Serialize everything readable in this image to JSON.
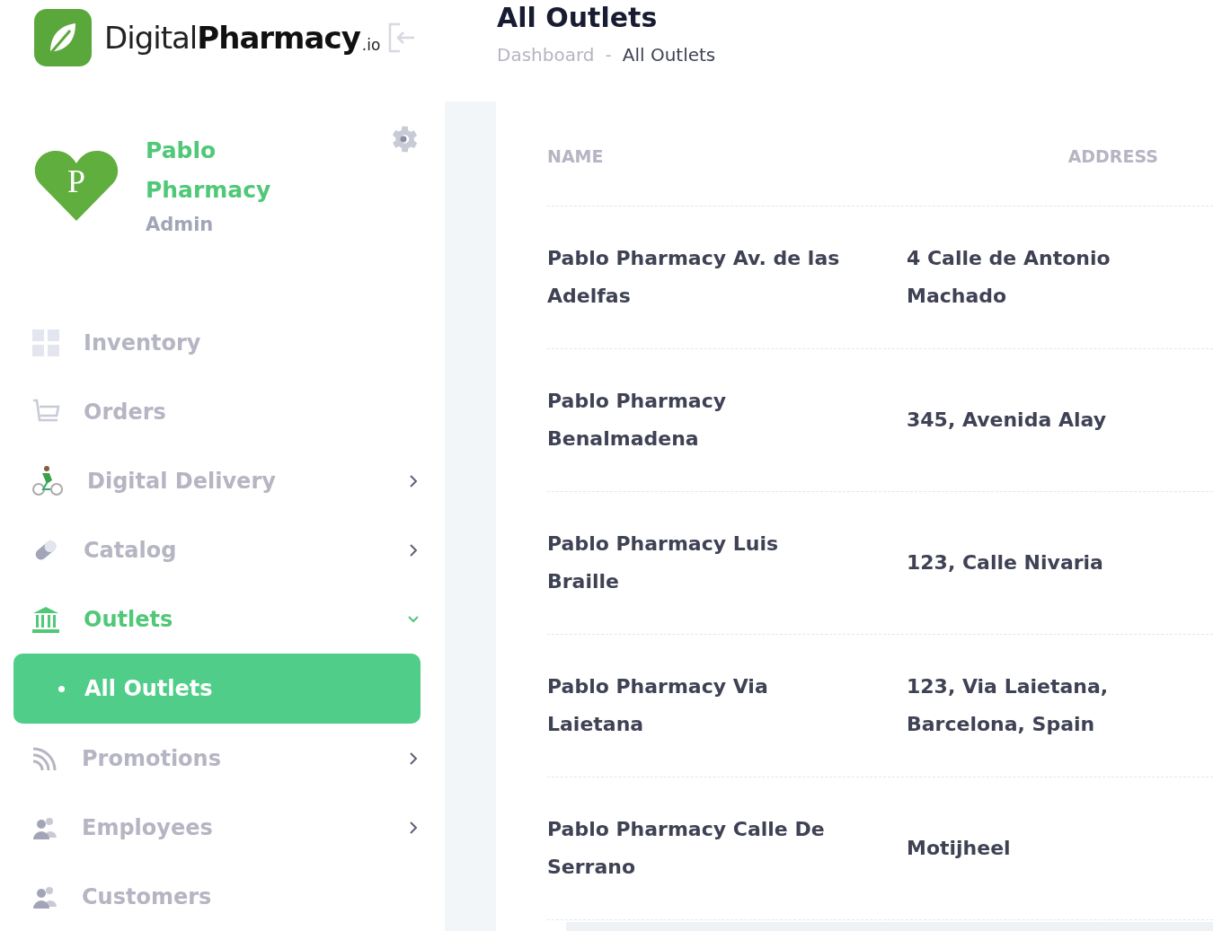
{
  "brand": {
    "name": "Digital**Pharmacy**",
    "suffix": ".io"
  },
  "header": {
    "title": "All Outlets",
    "breadcrumb": [
      {
        "kind": "link",
        "text": "Dashboard"
      },
      {
        "kind": "separator",
        "text": "-"
      },
      {
        "kind": "current",
        "text": "All Outlets"
      }
    ]
  },
  "profile": {
    "initial": "P",
    "name": "Pablo Pharmacy",
    "role": "Admin"
  },
  "sidebar": {
    "items": [
      {
        "label": "Inventory",
        "kind": "grid",
        "active": false
      },
      {
        "label": "Orders",
        "kind": "cart",
        "active": false
      },
      {
        "label": "Digital Delivery",
        "kind": "bike",
        "active": false,
        "expanded": false
      },
      {
        "label": "Catalog",
        "kind": "pill",
        "active": false,
        "expanded": false
      },
      {
        "label": "Outlets",
        "kind": "bank",
        "active": true,
        "expanded": true,
        "children": [
          {
            "label": "All Outlets",
            "selected": true
          }
        ]
      },
      {
        "label": "Promotions",
        "kind": "rss",
        "active": false,
        "expanded": false
      },
      {
        "label": "Employees",
        "kind": "people",
        "active": false,
        "expanded": false
      },
      {
        "label": "Customers",
        "kind": "people",
        "active": false
      }
    ]
  },
  "table": {
    "columns": [
      "NAME",
      "ADDRESS"
    ],
    "rows": [
      {
        "name": "Pablo Pharmacy Av. de las Adelfas",
        "address": "4 Calle de Antonio Machado"
      },
      {
        "name": "Pablo Pharmacy Benalmadena",
        "address": "345, Avenida Alay"
      },
      {
        "name": "Pablo Pharmacy Luis Braille",
        "address": "123, Calle Nivaria"
      },
      {
        "name": "Pablo Pharmacy Via Laietana",
        "address": "123, Via Laietana, Barcelona, Spain"
      },
      {
        "name": "Pablo Pharmacy Calle De Serrano",
        "address": "Motijheel"
      }
    ]
  }
}
